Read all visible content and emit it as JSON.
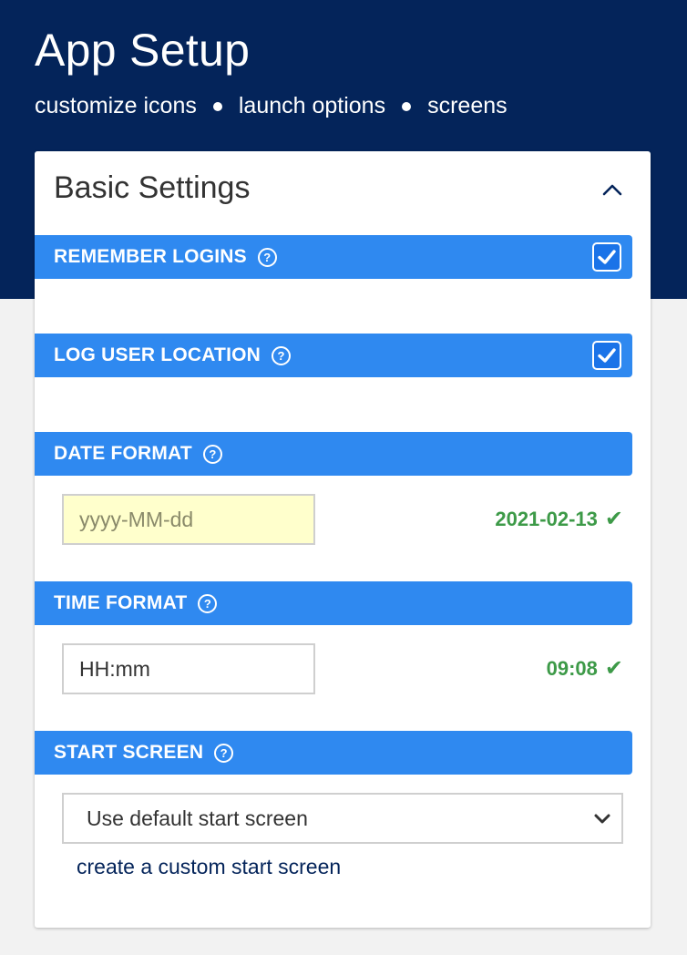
{
  "header": {
    "title": "App Setup",
    "nav": [
      "customize icons",
      "launch options",
      "screens"
    ]
  },
  "card": {
    "title": "Basic Settings",
    "collapse_icon": "chevron-up-icon"
  },
  "sections": {
    "remember_logins": {
      "label": "REMEMBER LOGINS",
      "help": "?",
      "checked": true
    },
    "log_user_location": {
      "label": "LOG USER LOCATION",
      "help": "?",
      "checked": true
    },
    "date_format": {
      "label": "DATE FORMAT",
      "help": "?",
      "placeholder": "yyyy-MM-dd",
      "value": "",
      "preview": "2021-02-13",
      "preview_icon": "✔"
    },
    "time_format": {
      "label": "TIME FORMAT",
      "help": "?",
      "placeholder": "",
      "value": "HH:mm",
      "preview": "09:08",
      "preview_icon": "✔"
    },
    "start_screen": {
      "label": "START SCREEN",
      "help": "?",
      "selected": "Use default start screen",
      "link": "create a custom start screen"
    }
  },
  "colors": {
    "header_bg": "#04245a",
    "section_bar": "#2f89f0",
    "checkbox": "#1a73e8",
    "preview_ok": "#3d9a48",
    "highlight_input": "#ffffcc"
  }
}
